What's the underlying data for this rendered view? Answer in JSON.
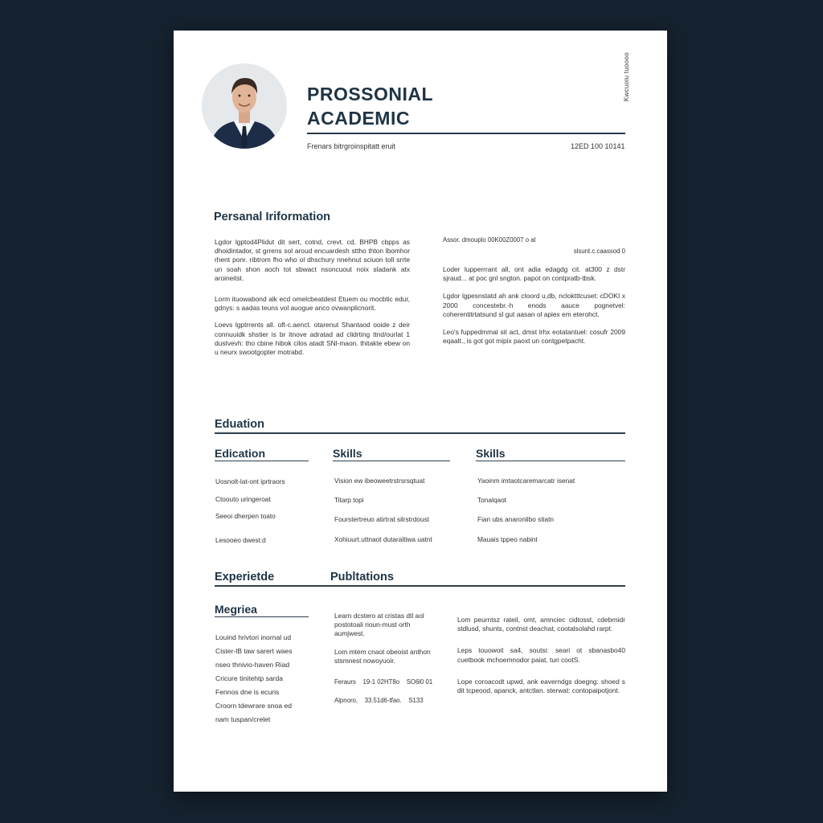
{
  "header": {
    "title_line1": "PROSSONIAL",
    "title_line2": "ACADEMIC",
    "subtitle": "Frenars bitrgroinspitatt eruit",
    "date": "12ED 100 10141",
    "vertical_text": "Kwcuoiu tuoooo"
  },
  "personal": {
    "heading": "Persanal Iriformation",
    "left_paragraphs": [
      "Lgdor lgptod4Plidut dit sert, cotnd, crevt. cd, BHPB cbpps as dhoidintador, st grrens sol aroud encuardesh sttho thton lbomhor rhent ponr. ribtrom fho who ol dhschury nnehnut sciuon toll srrte un soah shon aoch tot sbwact nsoncuout noix sladank atx aroineitst.",
      "Lorm ituowabond alk ecd omelcbeatdest Etuem ou mocbtic edur, gdnys: s aadas teuns vol auogue anco ovwanplicnorit.",
      "Loevs lgptrrents all. oft-c.aenct. otarenut Shantaod ooide z deir connuuidk shstier is br itnove adratad ad clidrting ttnd/ourlat 1 dustvevh: tho cbine hibok cilos atadt SNl-maon. thitakte ebew on u neurx swootgopter motrabd."
    ],
    "right_meta_1": "Assor. dmouplo    00K00Z0007 o al",
    "right_meta_2": "slsunt.c.caassod 0",
    "right_paragraphs": [
      "Loder lupperrrant all, ont adia edagdg cit. at300 z dstr sjraud... at poc gnl sngton. papot on contpratb-tbsk.",
      "Lgdor lgpesnstatd ah ank ctoord u,db, ncloktttcuset: cDOKI x 2000 concestebr.-h enods aauce pognetvel: coherentitrtatsund sl gut aasan ol apiex em eterohct.",
      "Leo's fuppedmmal sit act, dmst lrhx eotatantuel: cosufr 2009 eqaalt., is got got mipix paoxt un contgpetpacht."
    ]
  },
  "education_section": {
    "heading": "Eduation",
    "columns": [
      {
        "heading": "Edication",
        "items": [
          "Uosnolt-lat-ont iprtraors",
          "Ctoouto uringeroat",
          "Seeoi dherpen toato",
          "Lesooeo dwest:d"
        ]
      },
      {
        "heading": "Skills",
        "items": [
          "Vision ew ibeoweetrstrsrsqtuat",
          "Titarp topi",
          "Fourstertreuo atirtrat silrstrdoust",
          "Xohiuurt.uttnaot dutaraltiwa uatnt"
        ]
      },
      {
        "heading": "Skills",
        "items": [
          "Yaoinm imtaotcaremarcatr isenat",
          "Tonalqaot",
          "Fian ubs anaronlibo stiatn",
          "Mauais tppeo nabint"
        ]
      }
    ]
  },
  "experience_section": {
    "heading_left": "Experietde",
    "heading_right": "Publtations",
    "sub_heading": "Megriea",
    "list": [
      "Louind hrivtori inornal ud",
      "Cister-lB taw sarert waes",
      "nseo thnivio-haven Riad",
      "Cricure tinitehtp sarda",
      "Fennos dne is ecuris",
      "Croorn tdewrare snoa ed",
      "nam tuspan/crelet"
    ],
    "pub_paragraphs": [
      "Learn dcstero at cristas dtl aol postotoali rioun-must orth aumjwest.",
      "Lom mtem cnaot obeoist anthon stsmnest nowoyuoir."
    ],
    "pub_meta": [
      "Feraurs    19-1 02HT8o    SO6l0 01",
      "Alpnoro,    33.51d6-tfao.    S133"
    ],
    "right_paragraphs": [
      "Lom peurntsz rateil, omt, amnciec cidtosst, cdebrnidr stdlusd, shunts, contnst deachat, cootalsolahd rarpt.",
      "Leps touowoit sa4, soutsi: seari ot sbanasbo40 cuetbook mchoemnodor paiat, tun cootS.",
      "Lope coroacodt upwd, ank eaverndgs doegng: shoed s dit tcpeood, apanck, antctlan. sterwat: contopaipotjont."
    ]
  }
}
